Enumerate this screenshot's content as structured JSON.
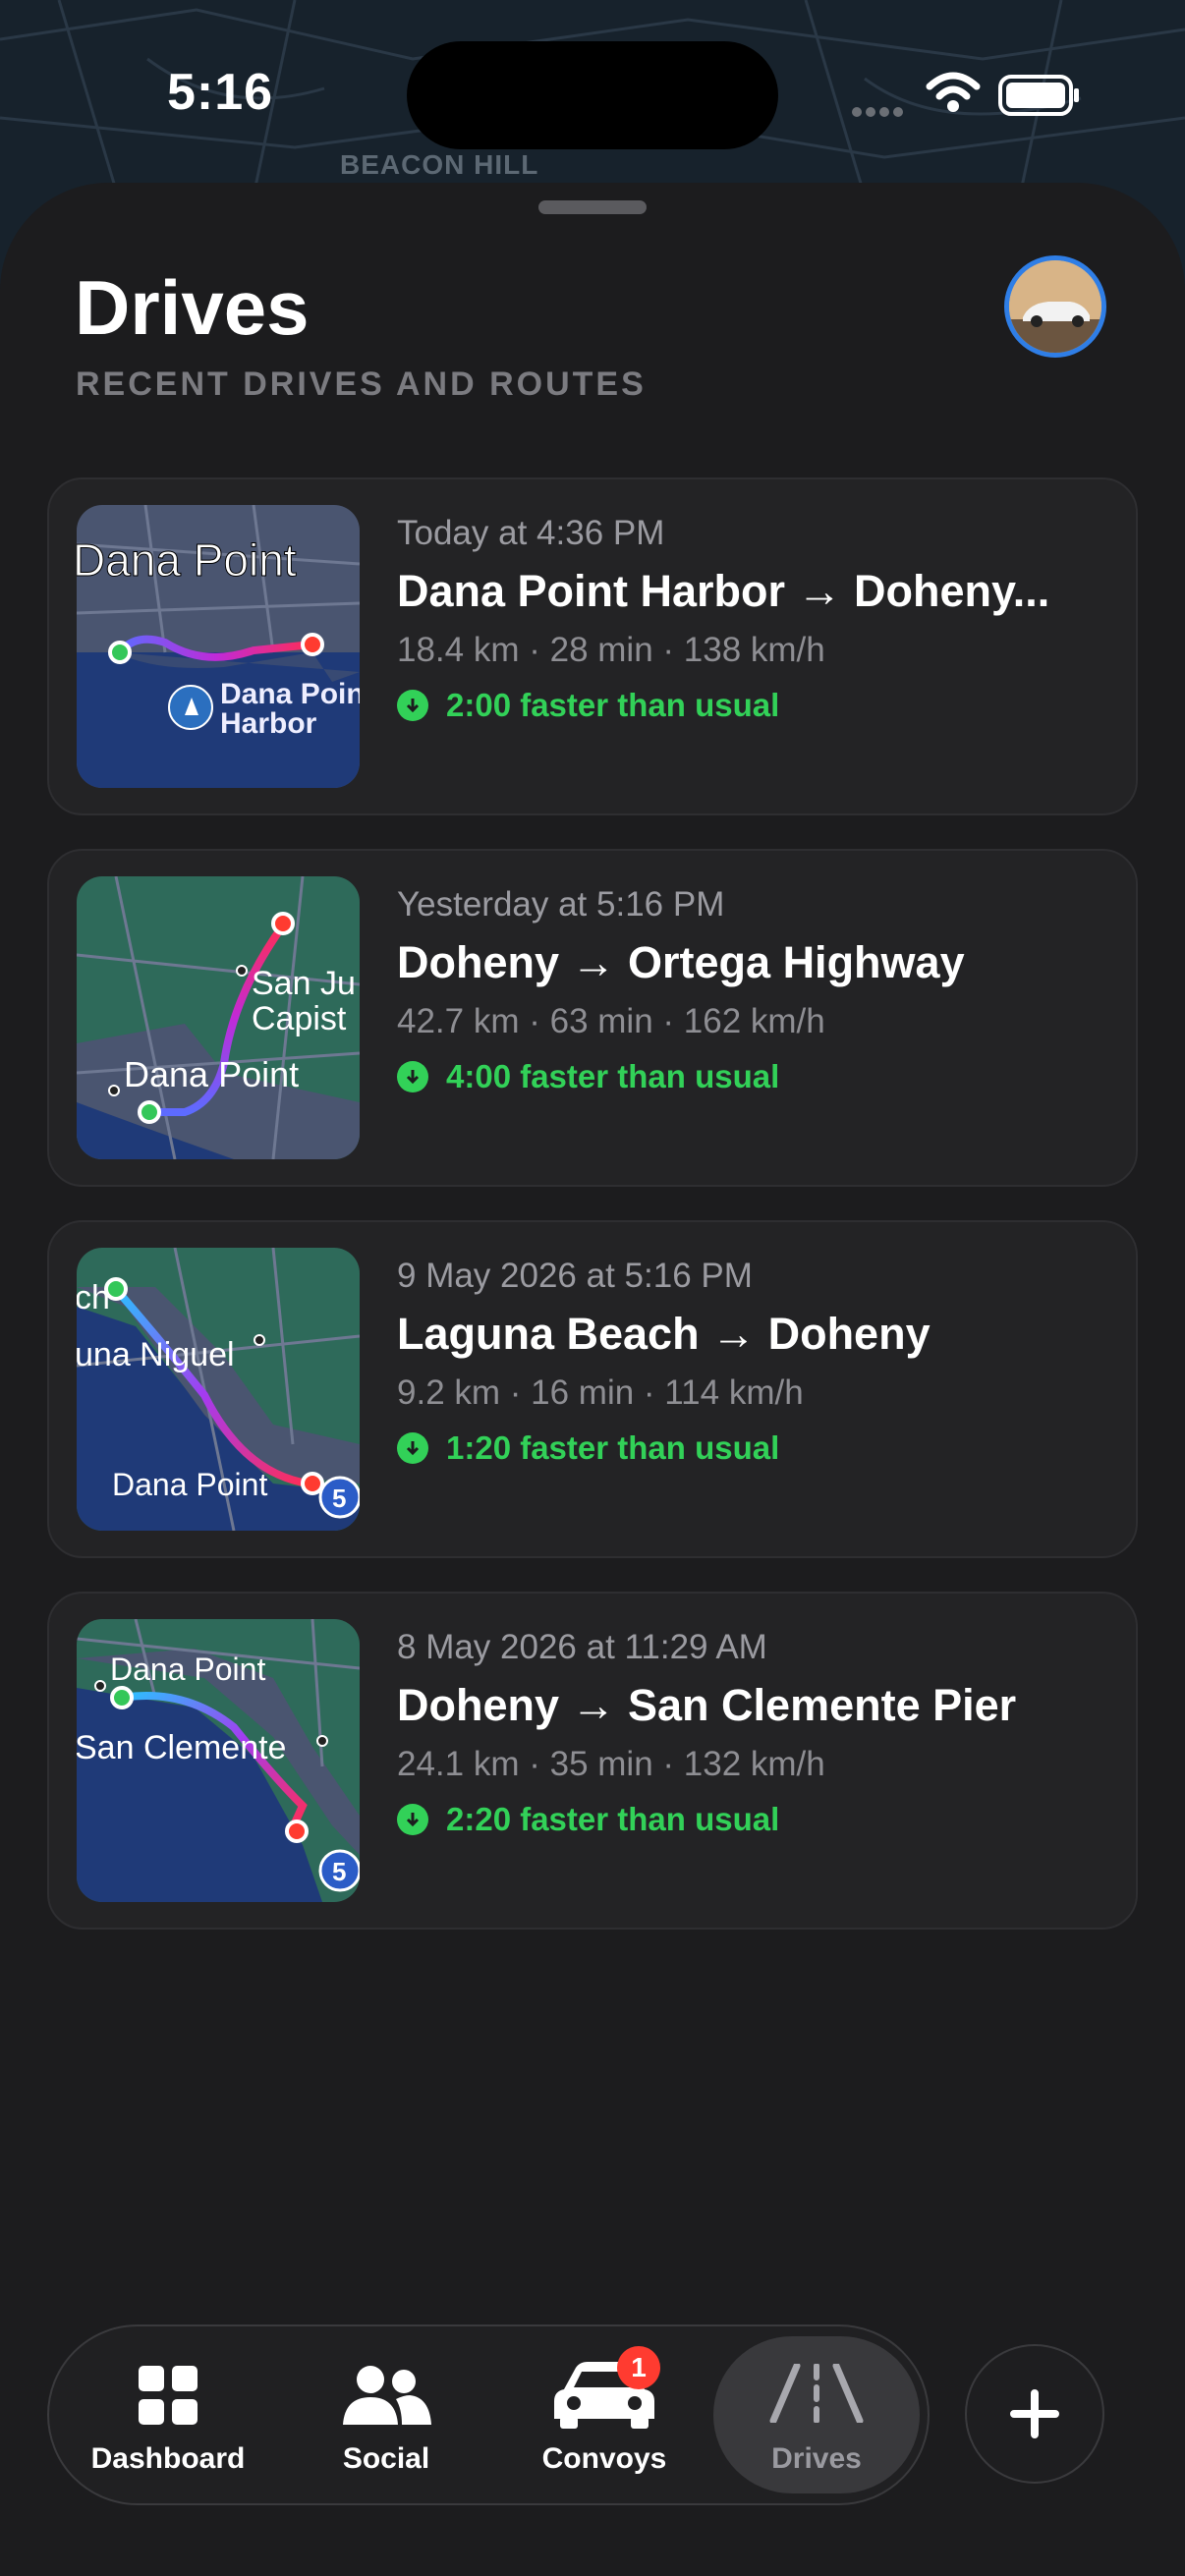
{
  "status": {
    "time": "5:16"
  },
  "background": {
    "map_label": "BEACON HILL"
  },
  "header": {
    "title": "Drives",
    "subtitle": "RECENT DRIVES AND ROUTES"
  },
  "drives": [
    {
      "when": "Today at 4:36 PM",
      "route": "Dana Point Harbor → Doheny...",
      "stats": "18.4 km · 28 min · 138 km/h",
      "faster": "2:00 faster than usual",
      "map_labels": [
        "Dana Point",
        "Dana Point",
        "Harbor"
      ]
    },
    {
      "when": "Yesterday at 5:16 PM",
      "route": "Doheny → Ortega Highway",
      "stats": "42.7 km · 63 min · 162 km/h",
      "faster": "4:00 faster than usual",
      "map_labels": [
        "San Ju",
        "Capist",
        "Dana Point"
      ]
    },
    {
      "when": "9 May 2026 at 5:16 PM",
      "route": "Laguna Beach → Doheny",
      "stats": "9.2 km · 16 min · 114 km/h",
      "faster": "1:20 faster than usual",
      "map_labels": [
        "ch",
        "una Niguel",
        "Dana Point",
        "5"
      ]
    },
    {
      "when": "8 May 2026 at 11:29 AM",
      "route": "Doheny → San Clemente Pier",
      "stats": "24.1 km · 35 min · 132 km/h",
      "faster": "2:20 faster than usual",
      "map_labels": [
        "Dana Point",
        "San Clemente",
        "5"
      ]
    }
  ],
  "tabbar": {
    "tabs": [
      {
        "label": "Dashboard",
        "icon": "grid-icon"
      },
      {
        "label": "Social",
        "icon": "people-icon"
      },
      {
        "label": "Convoys",
        "icon": "car-icon",
        "badge": "1"
      },
      {
        "label": "Drives",
        "icon": "road-icon",
        "active": true
      }
    ],
    "add_icon": "plus-icon"
  },
  "colors": {
    "accent_green": "#32d158",
    "badge_red": "#ff3b30",
    "avatar_ring": "#2f7ee6"
  }
}
